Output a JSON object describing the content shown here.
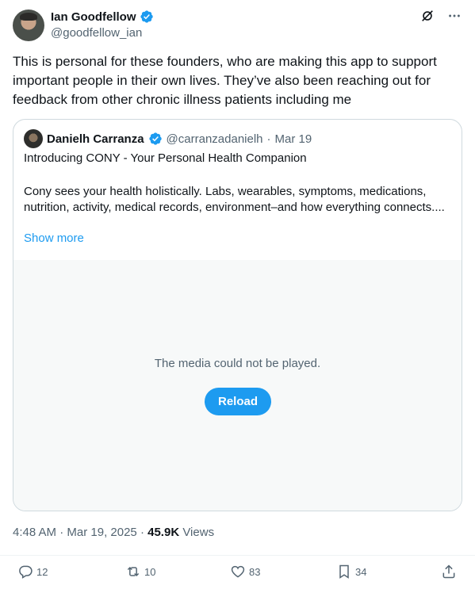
{
  "author": {
    "name": "Ian Goodfellow",
    "handle": "@goodfellow_ian"
  },
  "tweet_text": "This is personal for these founders, who are making this app to support important people in their own lives. They’ve also been reaching out for feedback from other chronic illness patients including me",
  "quote": {
    "name": "Danielh Carranza",
    "handle": "@carranzadanielh",
    "separator": "·",
    "date": "Mar 19",
    "title": "Introducing CONY - Your Personal Health Companion",
    "body": "Cony sees your health holistically. Labs, wearables, symptoms, medications, nutrition, activity, medical records, environment–and how everything connects....",
    "show_more": "Show more",
    "media_message": "The media could not be played.",
    "reload_label": "Reload"
  },
  "meta": {
    "time": "4:48 AM",
    "sep1": "·",
    "date": "Mar 19, 2025",
    "sep2": "·",
    "views_count": "45.9K",
    "views_label": "Views"
  },
  "actions": {
    "replies": "12",
    "reposts": "10",
    "likes": "83",
    "bookmarks": "34"
  },
  "colors": {
    "accent": "#1d9bf0",
    "muted": "#536471",
    "text": "#0f1419",
    "border": "#cfd9de"
  }
}
